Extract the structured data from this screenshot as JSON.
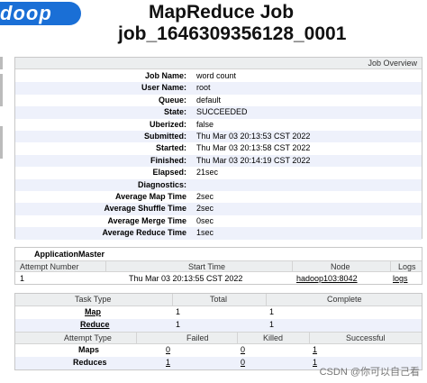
{
  "header": {
    "logo_text": "doop",
    "title_line1": "MapReduce Job",
    "title_line2": "job_1646309356128_0001"
  },
  "overview": {
    "section_title": "Job Overview",
    "rows": [
      {
        "label": "Job Name:",
        "value": "word count"
      },
      {
        "label": "User Name:",
        "value": "root"
      },
      {
        "label": "Queue:",
        "value": "default"
      },
      {
        "label": "State:",
        "value": "SUCCEEDED"
      },
      {
        "label": "Uberized:",
        "value": "false"
      },
      {
        "label": "Submitted:",
        "value": "Thu Mar 03 20:13:53 CST 2022"
      },
      {
        "label": "Started:",
        "value": "Thu Mar 03 20:13:58 CST 2022"
      },
      {
        "label": "Finished:",
        "value": "Thu Mar 03 20:14:19 CST 2022"
      },
      {
        "label": "Elapsed:",
        "value": "21sec"
      },
      {
        "label": "Diagnostics:",
        "value": ""
      },
      {
        "label": "Average Map Time",
        "value": "2sec"
      },
      {
        "label": "Average Shuffle Time",
        "value": "2sec"
      },
      {
        "label": "Average Merge Time",
        "value": "0sec"
      },
      {
        "label": "Average Reduce Time",
        "value": "1sec"
      }
    ]
  },
  "application_master": {
    "title": "ApplicationMaster",
    "columns": [
      "Attempt Number",
      "Start Time",
      "Node",
      "Logs"
    ],
    "row": {
      "attempt": "1",
      "start_time": "Thu Mar 03 20:13:55 CST 2022",
      "node": "hadoop103:8042",
      "logs": "logs"
    }
  },
  "tasks": {
    "headers": {
      "task_type": "Task Type",
      "total": "Total",
      "complete": "Complete"
    },
    "rows": [
      {
        "type": "Map",
        "total": "1",
        "complete": "1"
      },
      {
        "type": "Reduce",
        "total": "1",
        "complete": "1"
      }
    ],
    "attempt_headers": {
      "attempt_type": "Attempt Type",
      "failed": "Failed",
      "killed": "Killed",
      "successful": "Successful"
    },
    "attempt_rows": [
      {
        "type": "Maps",
        "failed": "0",
        "killed": "0",
        "successful": "1"
      },
      {
        "type": "Reduces",
        "failed": "1",
        "killed": "0",
        "successful": "1"
      }
    ]
  },
  "watermark": "CSDN @你可以自己看"
}
